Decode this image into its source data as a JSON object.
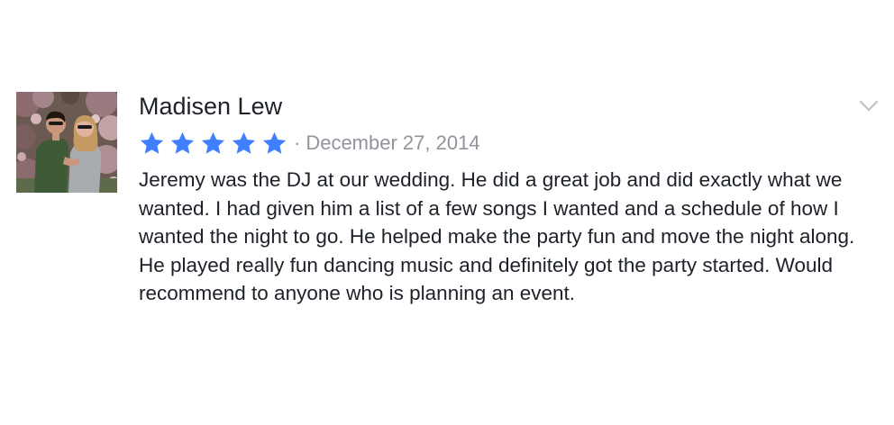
{
  "review": {
    "reviewer_name": "Madisen Lew",
    "rating": 5,
    "rating_max": 5,
    "separator": "·",
    "date": "December 27, 2014",
    "text": "Jeremy was the DJ at our wedding. He did a great job and did exactly what we wanted. I had given him a list of a few songs I wanted and a schedule of how I wanted the night to go. He helped make the party fun and move the night along. He played really fun dancing music and definitely got the party started. Would recommend to anyone who is planning an event.",
    "avatar_icon": "couple-photo",
    "menu_icon": "chevron-down-icon"
  },
  "colors": {
    "star": "#4080ff",
    "text": "#1d2129",
    "muted": "#90949c",
    "chevron": "#bec2c9"
  }
}
